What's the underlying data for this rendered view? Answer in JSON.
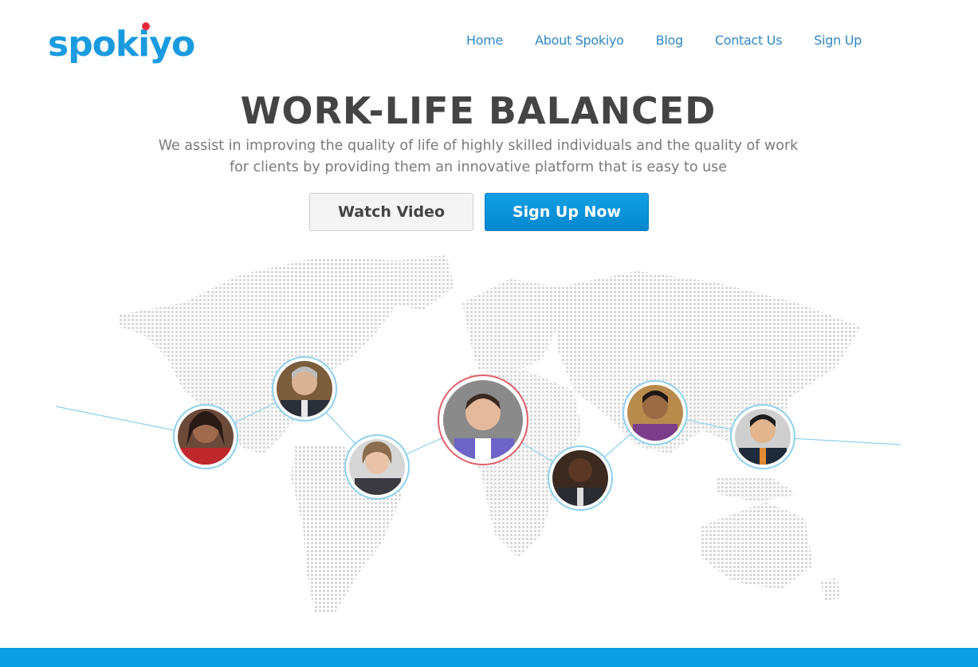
{
  "brand": {
    "logo_text": "spokiyo"
  },
  "nav": {
    "items": [
      {
        "label": "Home"
      },
      {
        "label": "About Spokiyo"
      },
      {
        "label": "Blog"
      },
      {
        "label": "Contact Us"
      },
      {
        "label": "Sign Up"
      }
    ]
  },
  "hero": {
    "title": "WORK-LIFE BALANCED",
    "subtitle": "We assist in improving the quality of life of highly skilled individuals and the quality of work for clients by providing them an innovative platform that is easy to use",
    "watch_video_label": "Watch Video",
    "signup_label": "Sign Up Now"
  },
  "colors": {
    "accent": "#0b9ee5",
    "link": "#2f88c6",
    "avatar_ring": "#8fd0ee",
    "featured_ring": "#e0606b"
  },
  "people": [
    {
      "name": "avatar-woman-red-dress",
      "featured": false
    },
    {
      "name": "avatar-man-grey-hair",
      "featured": false
    },
    {
      "name": "avatar-woman-blonde",
      "featured": false
    },
    {
      "name": "avatar-man-smiling-featured",
      "featured": true
    },
    {
      "name": "avatar-man-suit",
      "featured": false
    },
    {
      "name": "avatar-man-young",
      "featured": false
    },
    {
      "name": "avatar-man-glasses",
      "featured": false
    }
  ]
}
